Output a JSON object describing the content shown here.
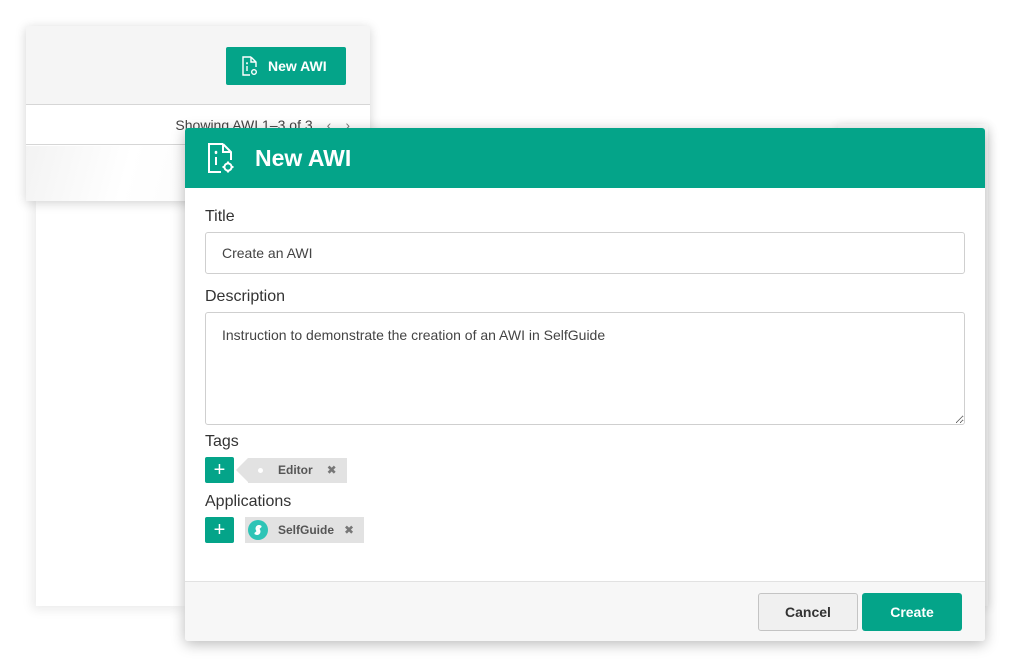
{
  "background": {
    "new_button_label": "New AWI",
    "pager_text": "Showing AWI 1–3 of 3",
    "prev_icon": "‹",
    "next_icon": "›"
  },
  "modal": {
    "title": "New AWI",
    "title_field": {
      "label": "Title",
      "value": "Create an AWI"
    },
    "description_field": {
      "label": "Description",
      "value": "Instruction to demonstrate the creation of an AWI in SelfGuide"
    },
    "tags": {
      "label": "Tags",
      "add_icon": "+",
      "items": [
        {
          "label": "Editor",
          "remove_icon": "✖"
        }
      ]
    },
    "applications": {
      "label": "Applications",
      "add_icon": "+",
      "items": [
        {
          "label": "SelfGuide",
          "remove_icon": "✖"
        }
      ]
    },
    "footer": {
      "cancel_label": "Cancel",
      "create_label": "Create"
    }
  },
  "colors": {
    "accent": "#04a489",
    "chip_bg": "#e2e2e2",
    "app_logo": "#2ec4b6"
  }
}
